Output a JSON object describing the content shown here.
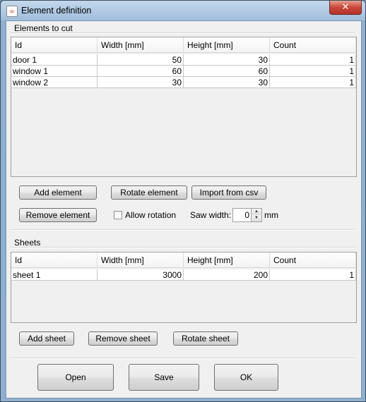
{
  "window": {
    "title": "Element definition",
    "close_label": "✕"
  },
  "elements_group": {
    "title": "Elements to cut",
    "columns": [
      "Id",
      "Width [mm]",
      "Height [mm]",
      "Count"
    ],
    "rows": [
      [
        "door 1",
        "50",
        "30",
        "1"
      ],
      [
        "window 1",
        "60",
        "60",
        "1"
      ],
      [
        "window 2",
        "30",
        "30",
        "1"
      ]
    ]
  },
  "element_buttons": {
    "add": "Add element",
    "rotate": "Rotate element",
    "import": "Import from csv",
    "remove": "Remove element"
  },
  "options": {
    "allow_rotation_label": "Allow rotation",
    "allow_rotation_checked": false,
    "saw_width_label": "Saw width:",
    "saw_width_value": "0",
    "saw_width_unit": "mm"
  },
  "sheets_group": {
    "title": "Sheets",
    "columns": [
      "Id",
      "Width [mm]",
      "Height [mm]",
      "Count"
    ],
    "rows": [
      [
        "sheet 1",
        "3000",
        "200",
        "1"
      ]
    ]
  },
  "sheet_buttons": {
    "add": "Add sheet",
    "remove": "Remove sheet",
    "rotate": "Rotate sheet"
  },
  "footer_buttons": {
    "open": "Open",
    "save": "Save",
    "ok": "OK"
  }
}
